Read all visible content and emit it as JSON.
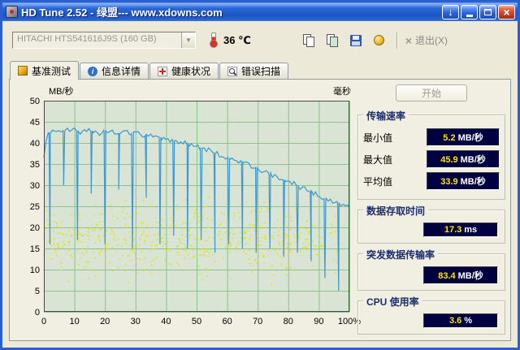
{
  "window": {
    "title": "HD Tune 2.52 - 绿盟--- www.xdowns.com"
  },
  "toolbar": {
    "drive": "HITACHI HTS541616J9S (160 GB)",
    "temperature": "36 ℃",
    "exit_label": "退出(X)"
  },
  "tabs": [
    {
      "label": "基准测试"
    },
    {
      "label": "信息详情"
    },
    {
      "label": "健康状况"
    },
    {
      "label": "错误扫描"
    }
  ],
  "panel": {
    "start_label": "开始",
    "transfer_rate": {
      "title": "传输速率",
      "rows": [
        {
          "label": "最小值",
          "value": "5.2",
          "unit": "MB/秒"
        },
        {
          "label": "最大值",
          "value": "45.9",
          "unit": "MB/秒"
        },
        {
          "label": "平均值",
          "value": "33.9",
          "unit": "MB/秒"
        }
      ]
    },
    "access_time": {
      "label": "数据存取时间",
      "value": "17.3",
      "unit": "ms"
    },
    "burst_rate": {
      "label": "突发数据传输率",
      "value": "83.4",
      "unit": "MB/秒"
    },
    "cpu_usage": {
      "label": "CPU 使用率",
      "value": "3.6",
      "unit": "%"
    }
  },
  "chart_data": {
    "type": "line+scatter",
    "title": "HD Tune benchmark: transfer rate (blue line, MB/s, left axis 0-50) and access time (yellow dots, ms) versus disk position 0-100%",
    "x_axis": {
      "range": [
        0,
        100
      ],
      "ticks": [
        0,
        10,
        20,
        30,
        40,
        50,
        60,
        70,
        80,
        90,
        100
      ],
      "suffix": "%"
    },
    "y_left": {
      "unit": "MB/秒",
      "range": [
        0,
        50
      ],
      "ticks": [
        0,
        5,
        10,
        15,
        20,
        25,
        30,
        35,
        40,
        45,
        50
      ]
    },
    "y_right": {
      "unit": "毫秒"
    },
    "grid": true,
    "colors": {
      "plot_bg": "#d9e4d4",
      "grid": "#8cc28c",
      "frame": "#4a4a4a",
      "line": "#3e97d0",
      "scatter": "#e4e400"
    },
    "transfer_line": {
      "base_points": [
        [
          0,
          36
        ],
        [
          0.8,
          41.5
        ],
        [
          3,
          43.2
        ],
        [
          6,
          42.6
        ],
        [
          9,
          43.4
        ],
        [
          12,
          42.4
        ],
        [
          15,
          43
        ],
        [
          18,
          42.3
        ],
        [
          21,
          42.8
        ],
        [
          24,
          42.1
        ],
        [
          27,
          42.6
        ],
        [
          30,
          42.3
        ],
        [
          33,
          41.7
        ],
        [
          36,
          41.9
        ],
        [
          39,
          41.1
        ],
        [
          42,
          40.6
        ],
        [
          45,
          40.2
        ],
        [
          48,
          39.6
        ],
        [
          51,
          39
        ],
        [
          54,
          38.3
        ],
        [
          57,
          37.3
        ],
        [
          60,
          36.6
        ],
        [
          63,
          35.8
        ],
        [
          66,
          35
        ],
        [
          69,
          34.2
        ],
        [
          72,
          33.3
        ],
        [
          75,
          32.3
        ],
        [
          78,
          31.4
        ],
        [
          81,
          30.6
        ],
        [
          84,
          29.6
        ],
        [
          87,
          28.6
        ],
        [
          90,
          27.5
        ],
        [
          93,
          26.4
        ],
        [
          96,
          25.6
        ],
        [
          100,
          24.7
        ]
      ],
      "spikes": [
        [
          2,
          16
        ],
        [
          6.5,
          30
        ],
        [
          11,
          17
        ],
        [
          15.5,
          28
        ],
        [
          20,
          16
        ],
        [
          24.5,
          29
        ],
        [
          29,
          15
        ],
        [
          33.5,
          27
        ],
        [
          38,
          16
        ],
        [
          42.5,
          18
        ],
        [
          47,
          15
        ],
        [
          51.5,
          17
        ],
        [
          56,
          14
        ],
        [
          60.5,
          16
        ],
        [
          65,
          15
        ],
        [
          69.5,
          14
        ],
        [
          74,
          15
        ],
        [
          78.5,
          13
        ],
        [
          83,
          14
        ],
        [
          87.5,
          12
        ],
        [
          92,
          8
        ],
        [
          96.5,
          5
        ]
      ]
    },
    "access_scatter": {
      "seed": 42,
      "count": 560,
      "x_max": 96.5,
      "ms_mean": 17,
      "ms_spread": 12,
      "ms_min": 4,
      "ms_max": 30
    }
  }
}
